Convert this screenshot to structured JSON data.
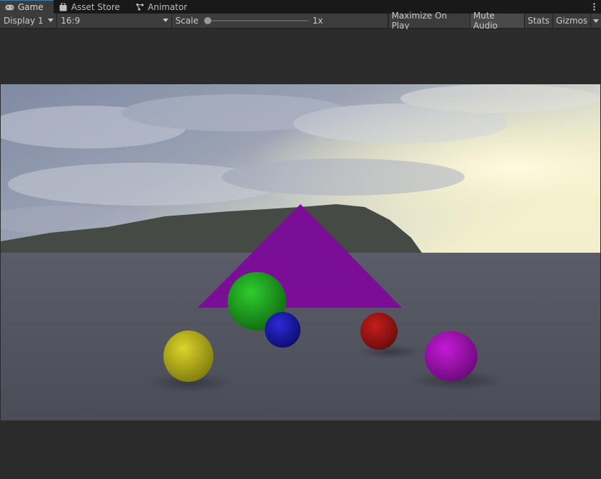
{
  "tabs": [
    {
      "label": "Game",
      "icon": "gamepad-icon",
      "active": true
    },
    {
      "label": "Asset Store",
      "icon": "shopping-bag-icon",
      "active": false
    },
    {
      "label": "Animator",
      "icon": "animator-icon",
      "active": false
    }
  ],
  "toolbar": {
    "display_label": "Display 1",
    "aspect_label": "16:9",
    "scale_label": "Scale",
    "scale_value": "1x",
    "scale_fraction": 0,
    "maximize_label": "Maximize On Play",
    "mute_label": "Mute Audio",
    "mute_on": true,
    "stats_label": "Stats",
    "gizmos_label": "Gizmos"
  },
  "colors": {
    "tab_active_accent": "#3a79bb",
    "sphere_green": "#1fae1f",
    "sphere_blue": "#1a1ab8",
    "sphere_red": "#b01515",
    "sphere_yellow": "#c8c21a",
    "sphere_purple": "#b012c4",
    "pyramid_purple": "#7a0f96"
  }
}
